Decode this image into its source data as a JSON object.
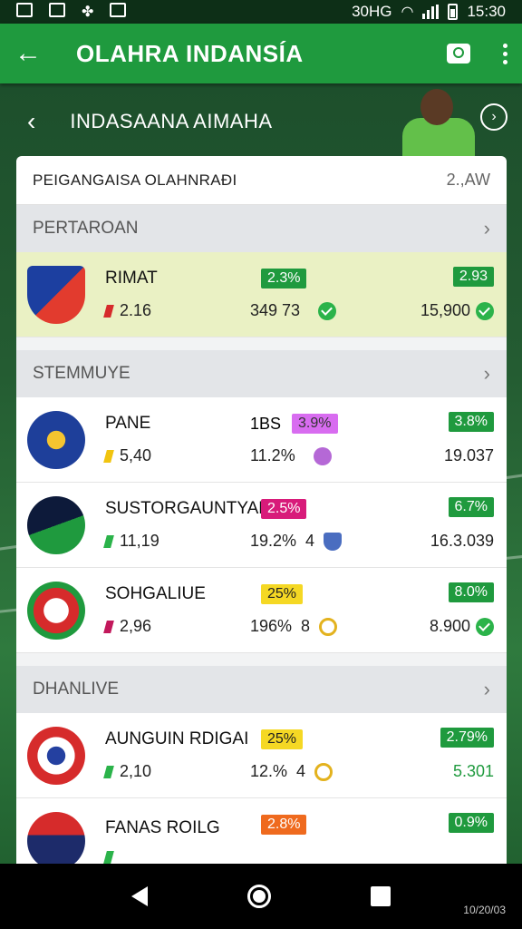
{
  "status_bar": {
    "network": "30HG",
    "time": "15:30"
  },
  "app_bar": {
    "back_glyph": "←",
    "title": "OLAHRA INDANSÍA"
  },
  "hero": {
    "back_glyph": "‹",
    "title": "INDASAANA AIMAHA",
    "next_glyph": "›"
  },
  "card": {
    "title": "PEIGANGAISA OLAHNRAĐI",
    "time": "2.,AW"
  },
  "sections": [
    {
      "label": "PERTAROAN",
      "rows": [
        {
          "name": "RIMAT",
          "stat": "2.16",
          "mark_color": "#d62b2b",
          "mid_badge": "2.3%",
          "mid_badge_color": "green",
          "mid_text": "349 73",
          "mid_icon": "check",
          "right_badge": "2.93",
          "right_badge_color": "green",
          "right_text": "15,900",
          "right_icon": "check",
          "logo": "shield-blue",
          "highlight": true
        }
      ]
    },
    {
      "label": "STEMMUYE",
      "rows": [
        {
          "name": "PANE",
          "stat": "5,40",
          "mark_color": "#f1c40f",
          "mid_prefix": "1BS",
          "mid_badge": "3.9%",
          "mid_badge_color": "purple",
          "mid_text": "11.2%",
          "mid_icon": "purple",
          "right_badge": "3.8%",
          "right_badge_color": "green",
          "right_text": "19.037",
          "right_icon": "",
          "logo": "blue-star",
          "highlight": false
        },
        {
          "name": "SUSTORGAUNTYANS",
          "stat": "11,19",
          "mark_color": "#2bb34a",
          "mid_prefix": "",
          "mid_badge": "2.5%",
          "mid_badge_color": "magenta",
          "mid_text": "19.2%",
          "mid_value": "4",
          "mid_icon": "shieldi",
          "right_badge": "6.7%",
          "right_badge_color": "green",
          "right_text": "16.3.039",
          "right_icon": "",
          "logo": "navy-green",
          "highlight": false
        },
        {
          "name": "SOHGALIUE",
          "stat": "2,96",
          "mark_color": "#c2185b",
          "mid_prefix": "",
          "mid_badge": "25%",
          "mid_badge_color": "yellow",
          "mid_text": "196%",
          "mid_value": "8",
          "mid_icon": "ring",
          "right_badge": "8.0%",
          "right_badge_color": "green",
          "right_text": "8.900",
          "right_icon": "check",
          "logo": "red-green",
          "highlight": false
        }
      ]
    },
    {
      "label": "DHANLIVE",
      "rows": [
        {
          "name": "AUNGUIN RDIGAI",
          "stat": "2,10",
          "mark_color": "#2bb34a",
          "mid_prefix": "",
          "mid_badge": "25%",
          "mid_badge_color": "yellow",
          "mid_text": "12.%",
          "mid_value": "4",
          "mid_icon": "ring",
          "right_badge": "2.79%",
          "right_badge_color": "green",
          "right_text": "5.301",
          "right_icon": "",
          "right_green": true,
          "logo": "red-white",
          "highlight": false
        },
        {
          "name": "FANAS ROILG",
          "stat": "",
          "mark_color": "#2bb34a",
          "mid_prefix": "",
          "mid_badge": "2.8%",
          "mid_badge_color": "orange",
          "mid_text": "",
          "mid_icon": "",
          "right_badge": "0.9%",
          "right_badge_color": "green",
          "right_text": "",
          "right_icon": "",
          "logo": "navy-gold",
          "highlight": false
        }
      ]
    }
  ],
  "nav_bar": {
    "code": "10/20/03"
  }
}
